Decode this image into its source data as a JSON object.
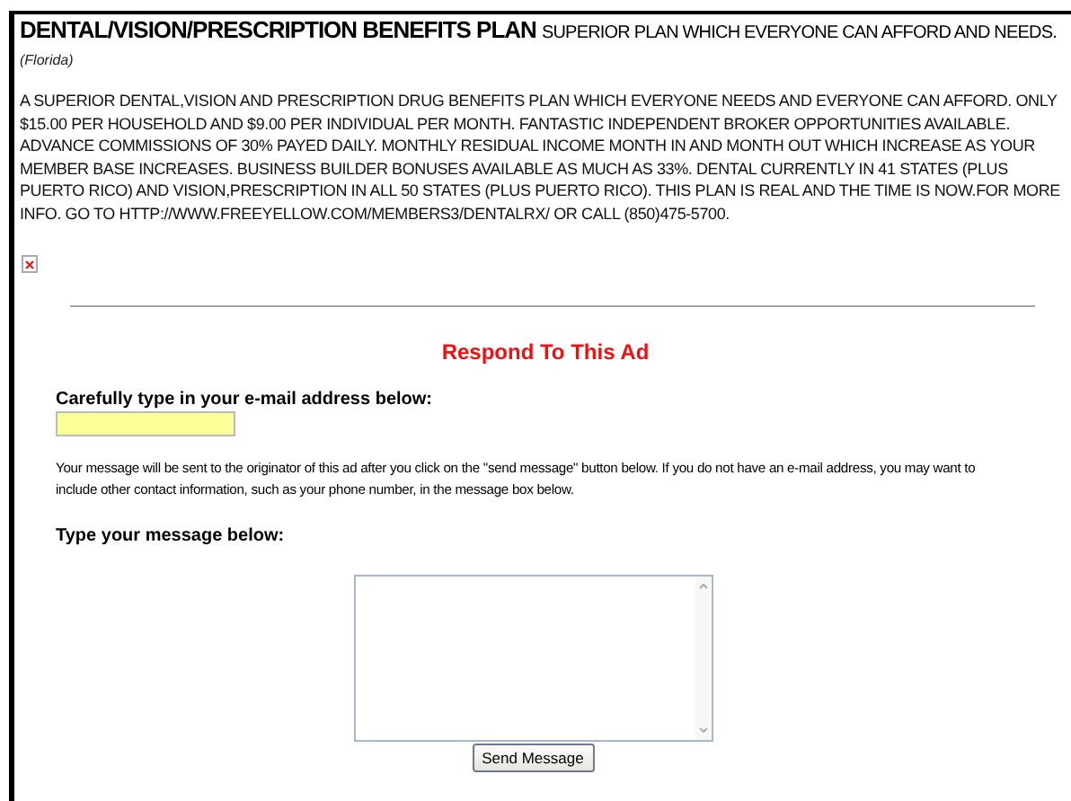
{
  "ad": {
    "title": "DENTAL/VISION/PRESCRIPTION BENEFITS PLAN",
    "subtitle": "SUPERIOR PLAN WHICH EVERYONE CAN AFFORD AND NEEDS.",
    "location": "(Florida)",
    "body": "A SUPERIOR DENTAL,VISION AND PRESCRIPTION DRUG BENEFITS PLAN WHICH EVERYONE NEEDS AND EVERYONE CAN AFFORD. ONLY $15.00 PER HOUSEHOLD AND $9.00 PER INDIVIDUAL PER MONTH. FANTASTIC INDEPENDENT BROKER OPPORTUNITIES AVAILABLE. ADVANCE COMMISSIONS OF 30% PAYED DAILY. MONTHLY RESIDUAL INCOME MONTH IN AND MONTH OUT WHICH INCREASE AS YOUR MEMBER BASE INCREASES. BUSINESS BUILDER BONUSES AVAILABLE AS MUCH AS 33%. DENTAL CURRENTLY IN 41 STATES (PLUS PUERTO RICO) AND VISION,PRESCRIPTION IN ALL 50 STATES (PLUS PUERTO RICO). THIS PLAN IS REAL AND THE TIME IS NOW.FOR MORE INFO. GO TO HTTP://WWW.FREEYELLOW.COM/MEMBERS3/DENTALRX/ OR CALL (850)475-5700."
  },
  "respond": {
    "heading": "Respond To This Ad",
    "email_label": "Carefully type in your e-mail address below:",
    "note": "Your message will be sent to the originator of this ad after you click on the \"send message\" button below. If you do not have an e-mail address, you may want to include other contact information, such as your phone number, in the message box below.",
    "message_label": "Type your message below:",
    "button": "Send Message"
  }
}
